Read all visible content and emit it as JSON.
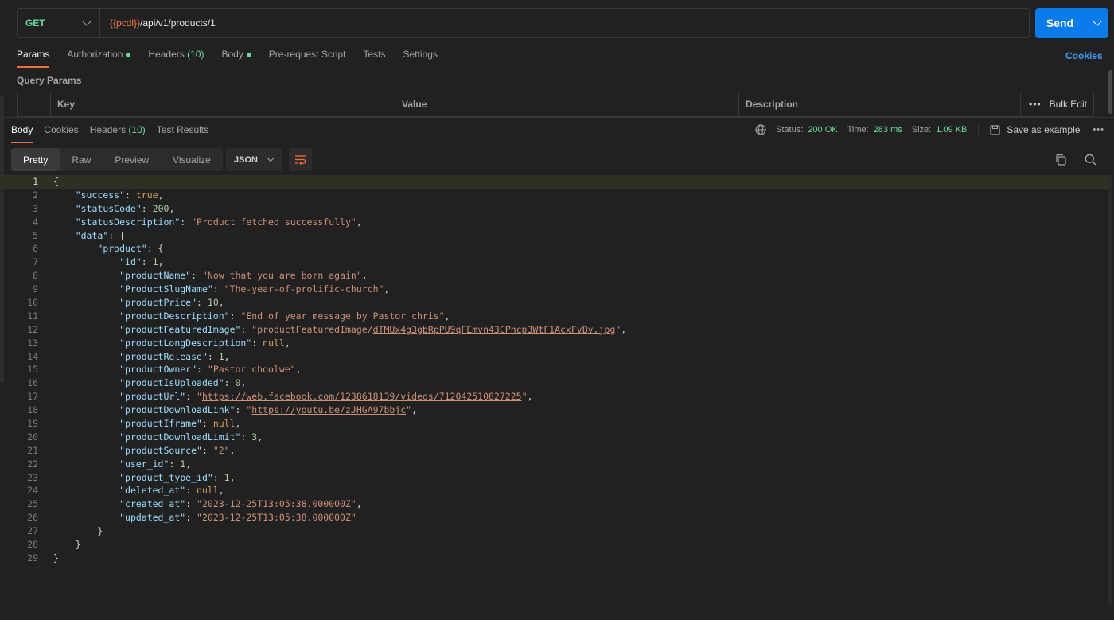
{
  "request": {
    "method": "GET",
    "url_var": "{{pcdl}}",
    "url_path": "/api/v1/products/1",
    "send_label": "Send"
  },
  "req_tabs": [
    {
      "label": "Params",
      "active": true
    },
    {
      "label": "Authorization",
      "dot": true
    },
    {
      "label": "Headers",
      "count": "(10)"
    },
    {
      "label": "Body",
      "dot": true
    },
    {
      "label": "Pre-request Script"
    },
    {
      "label": "Tests"
    },
    {
      "label": "Settings"
    }
  ],
  "cookies_label": "Cookies",
  "query_params": {
    "title": "Query Params",
    "columns": [
      "Key",
      "Value",
      "Description"
    ],
    "bulk_edit": "Bulk Edit"
  },
  "response": {
    "tabs": [
      {
        "label": "Body",
        "active": true
      },
      {
        "label": "Cookies"
      },
      {
        "label": "Headers",
        "count": "(10)"
      },
      {
        "label": "Test Results"
      }
    ],
    "status_label": "Status:",
    "status_value": "200 OK",
    "time_label": "Time:",
    "time_value": "283 ms",
    "size_label": "Size:",
    "size_value": "1.09 KB",
    "save_example": "Save as example",
    "formats": [
      "Pretty",
      "Raw",
      "Preview",
      "Visualize"
    ],
    "active_format": "Pretty",
    "language": "JSON"
  },
  "code_lines": [
    "{",
    "    \"success\": true,",
    "    \"statusCode\": 200,",
    "    \"statusDescription\": \"Product fetched successfully\",",
    "    \"data\": {",
    "        \"product\": {",
    "            \"id\": 1,",
    "            \"productName\": \"Now that you are born again\",",
    "            \"ProductSlugName\": \"The-year-of-prolific-church\",",
    "            \"productPrice\": 10,",
    "            \"productDescription\": \"End of year message by Pastor chris\",",
    "            \"productFeaturedImage\": \"productFeaturedImage/dTMUx4g3gbRpPU9qFEmvn43CPhcp3WtF1AcxFvBv.jpg\",",
    "            \"productLongDescription\": null,",
    "            \"productRelease\": 1,",
    "            \"productOwner\": \"Pastor choolwe\",",
    "            \"productIsUploaded\": 0,",
    "            \"productUrl\": \"https://web.facebook.com/1238618139/videos/712042510827225\",",
    "            \"productDownloadLink\": \"https://youtu.be/zJHGA97bbjc\",",
    "            \"productIframe\": null,",
    "            \"productDownloadLimit\": 3,",
    "            \"productSource\": \"2\",",
    "            \"user_id\": 1,",
    "            \"product_type_id\": 1,",
    "            \"deleted_at\": null,",
    "            \"created_at\": \"2023-12-25T13:05:38.000000Z\",",
    "            \"updated_at\": \"2023-12-25T13:05:38.000000Z\"",
    "        }",
    "    }",
    "}"
  ],
  "colors": {
    "accent": "#f26b3a",
    "send": "#097bed",
    "status_ok": "#6bdd9a",
    "link": "#3f9df5"
  },
  "icons": [
    "chevron-down-icon",
    "globe-icon",
    "save-icon",
    "more-icon",
    "wrap-icon",
    "copy-icon",
    "search-icon"
  ]
}
